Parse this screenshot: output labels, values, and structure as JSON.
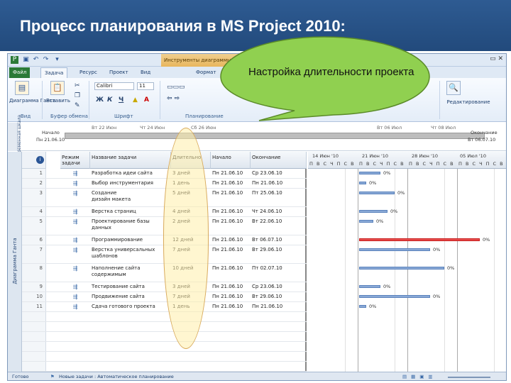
{
  "slide": {
    "title": "Процесс планирования в MS Project 2010:",
    "header_color": "#2a5388"
  },
  "callout": {
    "text": "Настройка длительности проекта",
    "fill": "#90d050"
  },
  "app": {
    "context_tab": "Инструменты диаграммы",
    "tabs": [
      "Файл",
      "Задача",
      "Ресурс",
      "Проект",
      "Вид",
      "Формат"
    ],
    "active_tab": "Задача"
  },
  "ribbon": {
    "view_button": "Диаграмма Ганта",
    "paste_button": "Вставить",
    "font_name": "Calibri",
    "font_size": "11",
    "bold": "Ж",
    "italic": "К",
    "underline": "Ч",
    "edit_button": "Редактирование",
    "groups": {
      "view": "Вид",
      "clipboard": "Буфер обмена",
      "font": "Шрифт",
      "schedule": "Планирование"
    }
  },
  "timeline": {
    "side_label": "Временная шкала",
    "dates": [
      "Вт 22 Июн",
      "Чт 24 Июн",
      "Сб 26 Июн",
      "Вт 06 Июл",
      "Чт 08 Июл"
    ],
    "start_label": "Начало",
    "start_date": "Пн 21.06.10",
    "end_label": "Окончание",
    "end_date": "Вт 06.07.10"
  },
  "grid": {
    "side_label": "Диаграмма Ганта",
    "columns": {
      "info": "i",
      "mode": "Режим задачи",
      "name": "Название задачи",
      "duration": "Длительно",
      "start": "Начало",
      "end": "Окончание"
    },
    "rows": [
      {
        "id": "1",
        "name": "Разработка идеи сайта",
        "duration": "3 дней",
        "start": "Пн 21.06.10",
        "end": "Ср 23.06.10"
      },
      {
        "id": "2",
        "name": "Выбор инструментария",
        "duration": "1 день",
        "start": "Пн 21.06.10",
        "end": "Пн 21.06.10"
      },
      {
        "id": "3",
        "name": "Создание",
        "name2": "дизайн макета",
        "duration": "5 дней",
        "start": "Пн 21.06.10",
        "end": "Пт 25.06.10"
      },
      {
        "id": "4",
        "name": "Верстка страниц",
        "duration": "4 дней",
        "start": "Пн 21.06.10",
        "end": "Чт 24.06.10"
      },
      {
        "id": "5",
        "name": "Проектирование базы",
        "name2": "данных",
        "duration": "2 дней",
        "start": "Пн 21.06.10",
        "end": "Вт 22.06.10"
      },
      {
        "id": "6",
        "name": "Программирование",
        "duration": "12 дней",
        "start": "Пн 21.06.10",
        "end": "Вт 06.07.10"
      },
      {
        "id": "7",
        "name": "Верстка универсальных",
        "name2": "шаблонов",
        "duration": "7 дней",
        "start": "Пн 21.06.10",
        "end": "Вт 29.06.10"
      },
      {
        "id": "8",
        "name": "Наполнение сайта",
        "name2": "содержимым",
        "duration": "10 дней",
        "start": "Пн 21.06.10",
        "end": "Пт 02.07.10"
      },
      {
        "id": "9",
        "name": "Тестирование сайта",
        "duration": "3 дней",
        "start": "Пн 21.06.10",
        "end": "Ср 23.06.10"
      },
      {
        "id": "10",
        "name": "Продвижение сайта",
        "duration": "7 дней",
        "start": "Пн 21.06.10",
        "end": "Вт 29.06.10"
      },
      {
        "id": "11",
        "name": "Сдача готового проекта",
        "duration": "1 день",
        "start": "Пн 21.06.10",
        "end": "Пн 21.06.10"
      }
    ]
  },
  "gantt": {
    "weeks": [
      "14 Июн '10",
      "21 Июн '10",
      "28 Июн '10",
      "05 Июл '10"
    ],
    "day_letters": "П В С Ч П С В",
    "pct": "0%",
    "bar_color": "#8aa9d6",
    "critical_color": "#e64b4b"
  },
  "status": {
    "ready": "Готово",
    "new_tasks": "Новые задачи : Автоматическое планирование"
  }
}
